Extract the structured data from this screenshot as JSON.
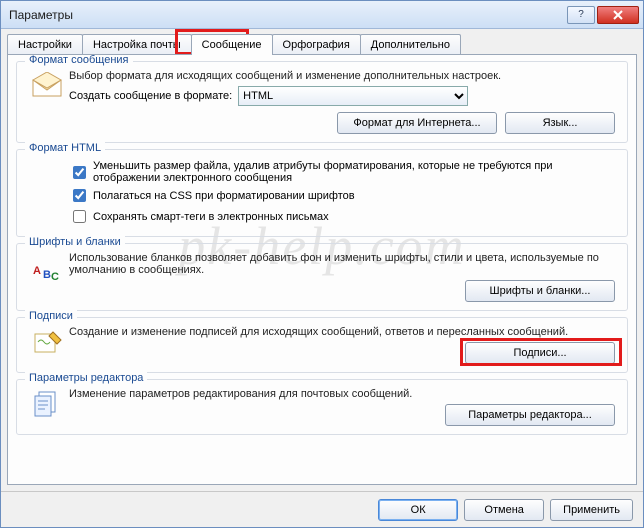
{
  "window": {
    "title": "Параметры"
  },
  "tabs": {
    "items": [
      {
        "label": "Настройки"
      },
      {
        "label": "Настройка почты"
      },
      {
        "label": "Сообщение"
      },
      {
        "label": "Орфография"
      },
      {
        "label": "Дополнительно"
      }
    ]
  },
  "group_format": {
    "label": "Формат сообщения",
    "desc": "Выбор формата для исходящих сообщений и изменение дополнительных настроек.",
    "create_label": "Создать сообщение в формате:",
    "format_value": "HTML",
    "btn_internet": "Формат для Интернета...",
    "btn_lang": "Язык..."
  },
  "group_html": {
    "label": "Формат HTML",
    "cb1": "Уменьшить размер файла, удалив атрибуты форматирования, которые не требуются при отображении электронного сообщения",
    "cb2": "Полагаться на CSS при форматировании шрифтов",
    "cb3": "Сохранять смарт-теги в электронных письмах"
  },
  "group_fonts": {
    "label": "Шрифты и бланки",
    "desc": "Использование бланков позволяет добавить фон и изменить шрифты, стили и цвета, используемые по умолчанию в сообщениях.",
    "btn": "Шрифты и бланки..."
  },
  "group_sig": {
    "label": "Подписи",
    "desc": "Создание и изменение подписей для исходящих сообщений, ответов и пересланных сообщений.",
    "btn": "Подписи..."
  },
  "group_editor": {
    "label": "Параметры редактора",
    "desc": "Изменение параметров редактирования для почтовых сообщений.",
    "btn": "Параметры редактора..."
  },
  "footer": {
    "ok": "ОК",
    "cancel": "Отмена",
    "apply": "Применить"
  },
  "watermark": "pk-help.com"
}
